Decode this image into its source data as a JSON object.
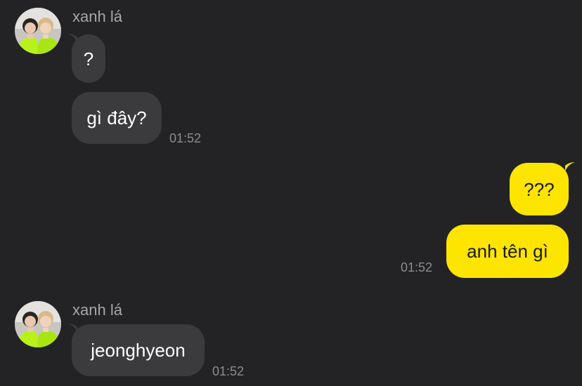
{
  "messages": [
    {
      "sender": "xanh lá",
      "direction": "incoming",
      "bubbles": [
        "?",
        "gì đây?"
      ],
      "time": "01:52"
    },
    {
      "direction": "outgoing",
      "bubbles": [
        "???",
        "anh tên gì"
      ],
      "time": "01:52"
    },
    {
      "sender": "xanh lá",
      "direction": "incoming",
      "bubbles": [
        "jeonghyeon"
      ],
      "time": "01:52"
    }
  ],
  "colors": {
    "background": "#232325",
    "incoming_bubble": "#3b3b3e",
    "outgoing_bubble": "#fee500",
    "sender_name": "#a6a6aa",
    "timestamp": "#8c8c90"
  },
  "icons": {
    "avatar": "contact-avatar-photo"
  }
}
